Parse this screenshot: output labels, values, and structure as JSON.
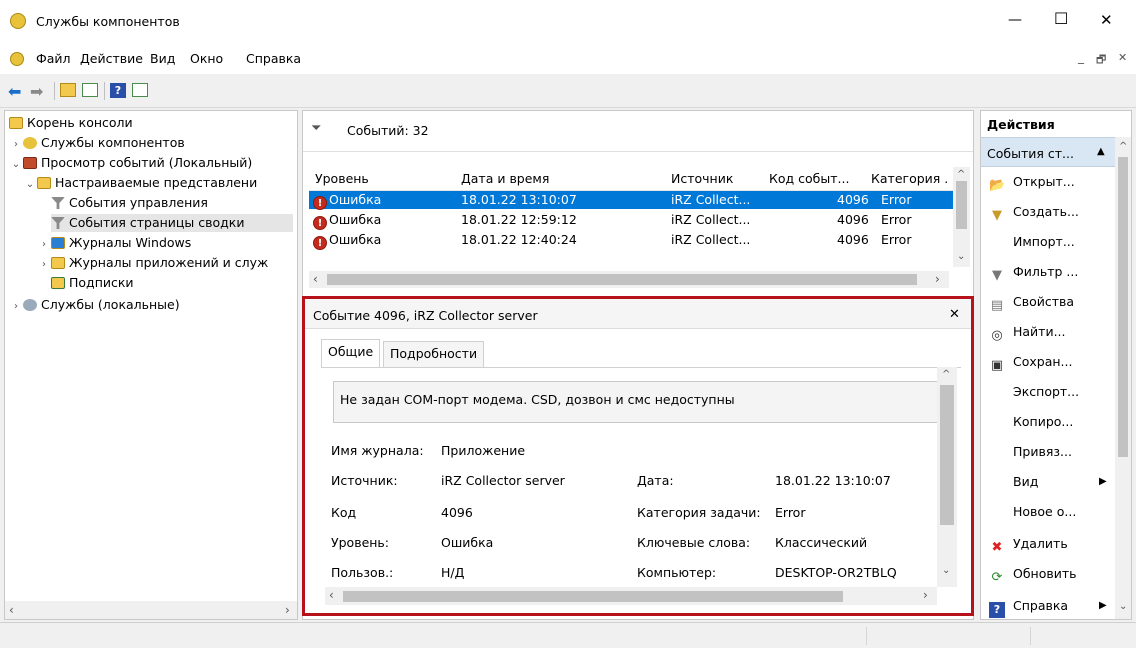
{
  "window": {
    "title": "Службы компонентов",
    "minimize": "—",
    "maximize": "☐",
    "close": "✕"
  },
  "menu": [
    "Файл",
    "Действие",
    "Вид",
    "Окно",
    "Справка"
  ],
  "mdi_controls": {
    "min": "_",
    "restore": "🗗",
    "close": "✕"
  },
  "tree": {
    "items": [
      {
        "label": "Корень консоли",
        "chev": ""
      },
      {
        "label": "Службы компонентов",
        "chev": "›"
      },
      {
        "label": "Просмотр событий (Локальный)",
        "chev": "⌄"
      },
      {
        "label": "Настраиваемые представлени",
        "chev": "⌄"
      },
      {
        "label": "События управления",
        "chev": ""
      },
      {
        "label": "События страницы сводки",
        "chev": ""
      },
      {
        "label": "Журналы Windows",
        "chev": "›"
      },
      {
        "label": "Журналы приложений и служ",
        "chev": "›"
      },
      {
        "label": "Подписки",
        "chev": ""
      },
      {
        "label": "Службы (локальные)",
        "chev": "›"
      }
    ]
  },
  "events": {
    "count_label": "Событий: 32",
    "columns": [
      "Уровень",
      "Дата и время",
      "Источник",
      "Код событ...",
      "Категория ."
    ],
    "rows": [
      {
        "level": "Ошибка",
        "datetime": "18.01.22 13:10:07",
        "source": "iRZ Collect...",
        "code": "4096",
        "category": "Error"
      },
      {
        "level": "Ошибка",
        "datetime": "18.01.22 12:59:12",
        "source": "iRZ Collect...",
        "code": "4096",
        "category": "Error"
      },
      {
        "level": "Ошибка",
        "datetime": "18.01.22 12:40:24",
        "source": "iRZ Collect...",
        "code": "4096",
        "category": "Error"
      }
    ]
  },
  "detail": {
    "title": "Событие 4096, iRZ Collector server",
    "close": "✕",
    "tabs": [
      "Общие",
      "Подробности"
    ],
    "description": "Не задан COM-порт модема. CSD, дозвон и смс недоступны",
    "fields": {
      "log_name_label": "Имя журнала:",
      "log_name": "Приложение",
      "source_label": "Источник:",
      "source": "iRZ Collector server",
      "date_label": "Дата:",
      "date": "18.01.22 13:10:07",
      "code_label": "Код",
      "code": "4096",
      "task_cat_label": "Категория задачи:",
      "task_cat": "Error",
      "level_label": "Уровень:",
      "level": "Ошибка",
      "keywords_label": "Ключевые слова:",
      "keywords": "Классический",
      "user_label": "Пользов.:",
      "user": "Н/Д",
      "computer_label": "Компьютер:",
      "computer": "DESKTOP-OR2TBLQ"
    }
  },
  "actions": {
    "header": "Действия",
    "section": "События ст...",
    "items": [
      {
        "label": "Открыт...",
        "icon": "folder-open-icon"
      },
      {
        "label": "Создать...",
        "icon": "filter-new-icon"
      },
      {
        "label": "Импорт...",
        "icon": ""
      },
      {
        "label": "Фильтр ...",
        "icon": "filter-icon"
      },
      {
        "label": "Свойства",
        "icon": "properties-icon"
      },
      {
        "label": "Найти...",
        "icon": "binoculars-icon"
      },
      {
        "label": "Сохран...",
        "icon": "save-icon"
      },
      {
        "label": "Экспорт...",
        "icon": ""
      },
      {
        "label": "Копиро...",
        "icon": ""
      },
      {
        "label": "Привяз...",
        "icon": ""
      },
      {
        "label": "Вид",
        "icon": ""
      },
      {
        "label": "Новое о...",
        "icon": ""
      },
      {
        "label": "Удалить",
        "icon": "delete-icon"
      },
      {
        "label": "Обновить",
        "icon": "refresh-icon"
      },
      {
        "label": "Справка",
        "icon": "help-icon"
      }
    ]
  }
}
